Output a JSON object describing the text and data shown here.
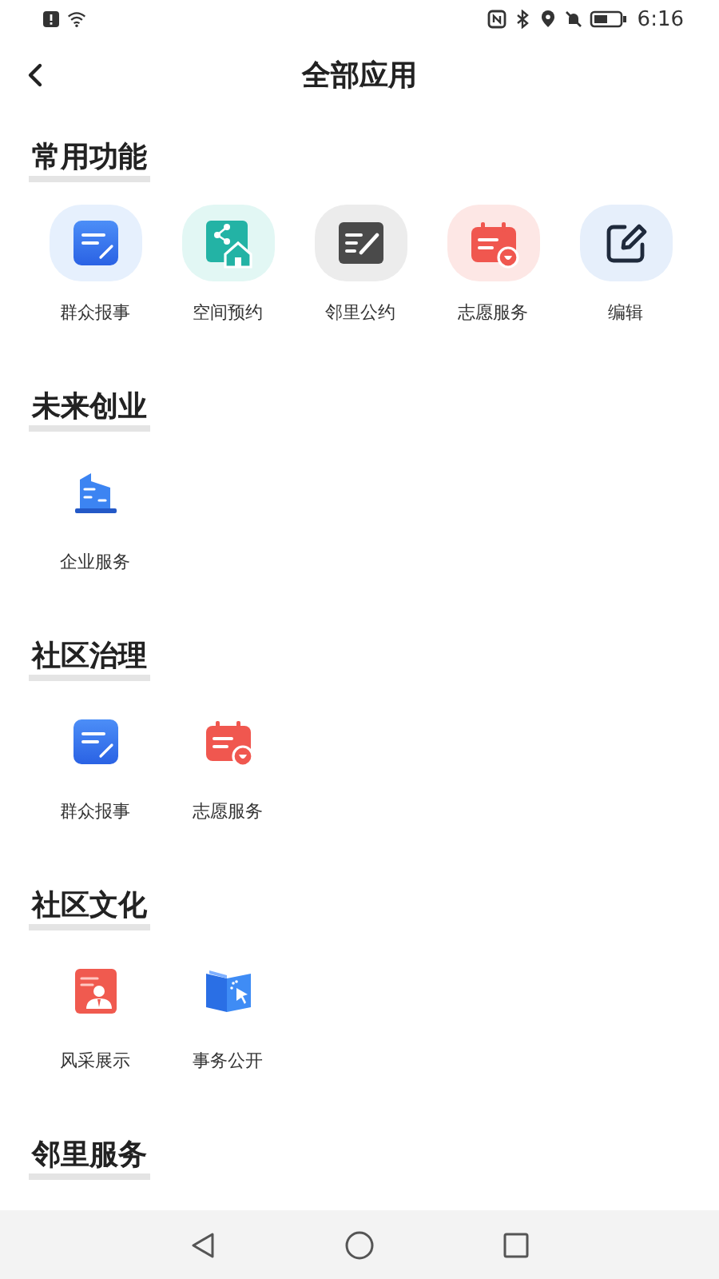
{
  "status_bar": {
    "time": "6:16"
  },
  "header": {
    "title": "全部应用"
  },
  "sections": [
    {
      "title": "常用功能",
      "tiled": true,
      "items": [
        {
          "label": "群众报事",
          "kind": "report"
        },
        {
          "label": "空间预约",
          "kind": "space"
        },
        {
          "label": "邻里公约",
          "kind": "pact"
        },
        {
          "label": "志愿服务",
          "kind": "volunteer"
        },
        {
          "label": "编辑",
          "kind": "edit"
        }
      ]
    },
    {
      "title": "未来创业",
      "tiled": false,
      "items": [
        {
          "label": "企业服务",
          "kind": "enterprise"
        }
      ]
    },
    {
      "title": "社区治理",
      "tiled": false,
      "items": [
        {
          "label": "群众报事",
          "kind": "report"
        },
        {
          "label": "志愿服务",
          "kind": "volunteer"
        }
      ]
    },
    {
      "title": "社区文化",
      "tiled": false,
      "items": [
        {
          "label": "风采展示",
          "kind": "showcase"
        },
        {
          "label": "事务公开",
          "kind": "open"
        }
      ]
    },
    {
      "title": "邻里服务"
    }
  ]
}
